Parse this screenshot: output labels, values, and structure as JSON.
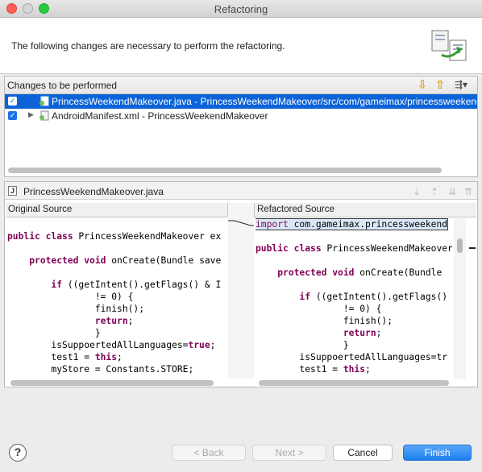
{
  "window": {
    "title": "Refactoring"
  },
  "header": {
    "message": "The following changes are necessary to perform the refactoring."
  },
  "changes": {
    "title": "Changes to be performed",
    "items": [
      {
        "label": "PrincessWeekendMakeover.java - PrincessWeekendMakeover/src/com/gameimax/princessweekendm",
        "checked": true,
        "selected": true
      },
      {
        "label": "AndroidManifest.xml - PrincessWeekendMakeover",
        "checked": true,
        "selected": false
      }
    ]
  },
  "preview": {
    "file_title": "PrincessWeekendMakeover.java",
    "original_label": "Original Source",
    "refactored_label": "Refactored Source",
    "original_lines": [
      "",
      "public class PrincessWeekendMakeover ex",
      "",
      "    protected void onCreate(Bundle save",
      "",
      "        if ((getIntent().getFlags() & I",
      "                != 0) {",
      "                finish();",
      "                return;",
      "                }",
      "        isSuppoertedAllLanguages=true;",
      "        test1 = this;",
      "        myStore = Constants.STORE;",
      "        ...  .  .  ..."
    ],
    "refactored_lines": [
      "import com.gameimax.princessweekend",
      "",
      "public class PrincessWeekendMakeover",
      "",
      "    protected void onCreate(Bundle",
      "",
      "        if ((getIntent().getFlags()",
      "                != 0) {",
      "                finish();",
      "                return;",
      "                }",
      "        isSuppoertedAllLanguages=tr",
      "        test1 = this;",
      "        ...  .  .  ..."
    ]
  },
  "buttons": {
    "help": "?",
    "back": "< Back",
    "next": "Next >",
    "cancel": "Cancel",
    "finish": "Finish"
  },
  "colors": {
    "selection": "#0b63d7",
    "keyword": "#7f0055",
    "primary_button": "#1e7ff0"
  }
}
